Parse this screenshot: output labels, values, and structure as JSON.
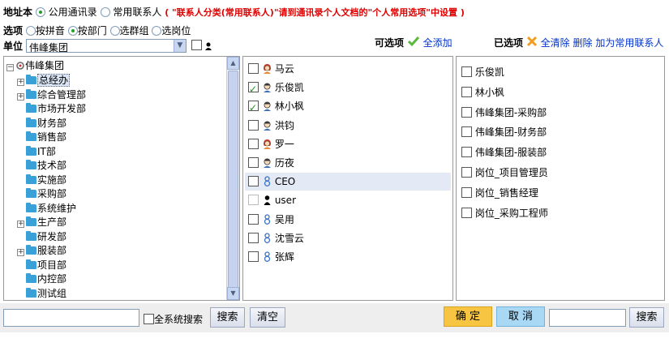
{
  "top": {
    "label": "地址本",
    "opt_public": "公用通讯录",
    "opt_common": "常用联系人",
    "note": "( \"联系人分类(常用联系人)\"请到通讯录个人文档的\"个人常用选项\"中设置 )"
  },
  "options": {
    "label": "选项",
    "items": [
      "按拼音",
      "按部门",
      "选群组",
      "选岗位"
    ]
  },
  "unit": {
    "label": "单位",
    "value": "伟峰集团"
  },
  "available": {
    "label": "可选项",
    "add_all": "全添加"
  },
  "selected": {
    "label": "已选项",
    "clear_all": "全清除",
    "delete": "删除",
    "add_common": "加为常用联系人"
  },
  "tree": {
    "root": "伟峰集团",
    "items": [
      {
        "label": "总经办",
        "expandable": true,
        "selected": true
      },
      {
        "label": "综合管理部",
        "expandable": true
      },
      {
        "label": "市场开发部",
        "expandable": false
      },
      {
        "label": "财务部",
        "expandable": false
      },
      {
        "label": "销售部",
        "expandable": false
      },
      {
        "label": "IT部",
        "expandable": false
      },
      {
        "label": "技术部",
        "expandable": false
      },
      {
        "label": "实施部",
        "expandable": false
      },
      {
        "label": "采购部",
        "expandable": false
      },
      {
        "label": "系统维护",
        "expandable": false
      },
      {
        "label": "生产部",
        "expandable": true
      },
      {
        "label": "研发部",
        "expandable": false
      },
      {
        "label": "服装部",
        "expandable": true
      },
      {
        "label": "项目部",
        "expandable": false
      },
      {
        "label": "内控部",
        "expandable": false
      },
      {
        "label": "测试组",
        "expandable": false
      }
    ]
  },
  "people": [
    {
      "name": "马云",
      "checked": false,
      "icon": "female-user-icon"
    },
    {
      "name": "乐俊凯",
      "checked": true,
      "icon": "male-user-icon"
    },
    {
      "name": "林小枫",
      "checked": true,
      "icon": "male-user-icon"
    },
    {
      "name": "洪钧",
      "checked": false,
      "icon": "male-user-icon"
    },
    {
      "name": "罗一",
      "checked": false,
      "icon": "female-user-icon"
    },
    {
      "name": "历夜",
      "checked": false,
      "icon": "male-user-icon"
    },
    {
      "name": "CEO",
      "checked": false,
      "icon": "generic-user-icon",
      "highlight": true
    },
    {
      "name": "user",
      "checked": false,
      "icon": "black-user-icon"
    },
    {
      "name": "吴用",
      "checked": false,
      "icon": "generic-user-icon"
    },
    {
      "name": "沈雪云",
      "checked": false,
      "icon": "generic-user-icon"
    },
    {
      "name": "张辉",
      "checked": false,
      "icon": "generic-user-icon"
    }
  ],
  "chosen": [
    "乐俊凯",
    "林小枫",
    "伟峰集团-采购部",
    "伟峰集团-财务部",
    "伟峰集团-服装部",
    "岗位_项目管理员",
    "岗位_销售经理",
    "岗位_采购工程师"
  ],
  "bottom": {
    "search_all": "全系统搜索",
    "search_btn": "搜索",
    "clear_btn": "清空",
    "ok_btn": "确 定",
    "cancel_btn": "取 消",
    "search_btn2": "搜索"
  },
  "colors": {
    "ok_bg": "#f7c542",
    "cancel_bg": "#a9d8f5",
    "note_red": "#e00000",
    "link_blue": "#0033cc"
  }
}
